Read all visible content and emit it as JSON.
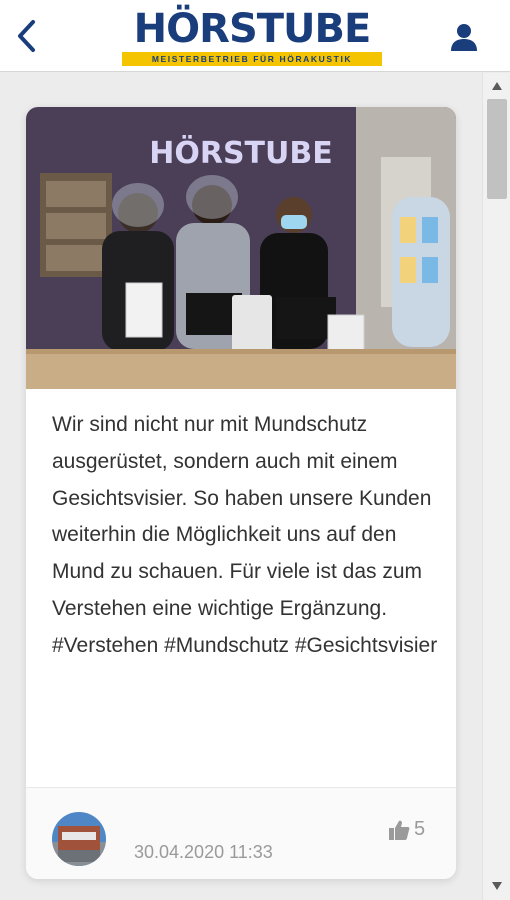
{
  "header": {
    "back_icon": "chevron-left-icon",
    "logo_name": "HÖRSTUBE",
    "logo_tagline": "MEISTERBETRIEB FÜR HÖRAKUSTIK",
    "user_icon": "user-icon",
    "brand_colors": {
      "navy": "#1a3d7c",
      "yellow": "#f5c400"
    }
  },
  "post": {
    "image_sign_text": "HÖRSTUBE",
    "text": "Wir sind nicht nur mit Mundschutz ausgerüstet, sondern auch mit einem Gesichtsvisier. So haben unsere Kunden weiterhin die Möglichkeit uns auf den Mund zu schauen. Für viele ist das zum Verstehen eine wichtige Ergänzung. #Verstehen #Mundschutz #Gesichtsvisier",
    "date": "30.04.2020 11:33",
    "likes": "5",
    "like_icon": "thumbs-up-icon"
  }
}
